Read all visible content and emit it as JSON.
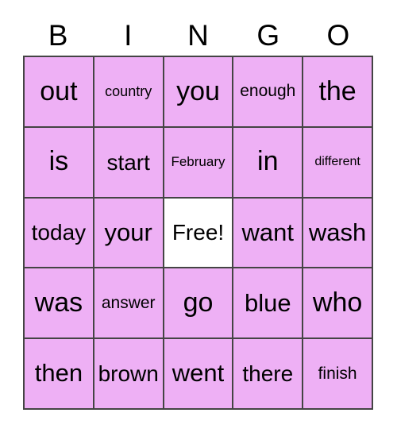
{
  "card": {
    "title_letters": [
      "B",
      "I",
      "N",
      "G",
      "O"
    ],
    "colors": {
      "cell_fill": "#eeb0f5",
      "free_fill": "#ffffff",
      "border": "#444444",
      "text": "#000000",
      "background": "#ffffff"
    },
    "grid": {
      "columns": 5,
      "rows": 5,
      "cells": [
        [
          {
            "text": "out",
            "free": false
          },
          {
            "text": "country",
            "free": false
          },
          {
            "text": "you",
            "free": false
          },
          {
            "text": "enough",
            "free": false
          },
          {
            "text": "the",
            "free": false
          }
        ],
        [
          {
            "text": "is",
            "free": false
          },
          {
            "text": "start",
            "free": false
          },
          {
            "text": "February",
            "free": false
          },
          {
            "text": "in",
            "free": false
          },
          {
            "text": "different",
            "free": false
          }
        ],
        [
          {
            "text": "today",
            "free": false
          },
          {
            "text": "your",
            "free": false
          },
          {
            "text": "Free!",
            "free": true
          },
          {
            "text": "want",
            "free": false
          },
          {
            "text": "wash",
            "free": false
          }
        ],
        [
          {
            "text": "was",
            "free": false
          },
          {
            "text": "answer",
            "free": false
          },
          {
            "text": "go",
            "free": false
          },
          {
            "text": "blue",
            "free": false
          },
          {
            "text": "who",
            "free": false
          }
        ],
        [
          {
            "text": "then",
            "free": false
          },
          {
            "text": "brown",
            "free": false
          },
          {
            "text": "went",
            "free": false
          },
          {
            "text": "there",
            "free": false
          },
          {
            "text": "finish",
            "free": false
          }
        ]
      ]
    }
  }
}
